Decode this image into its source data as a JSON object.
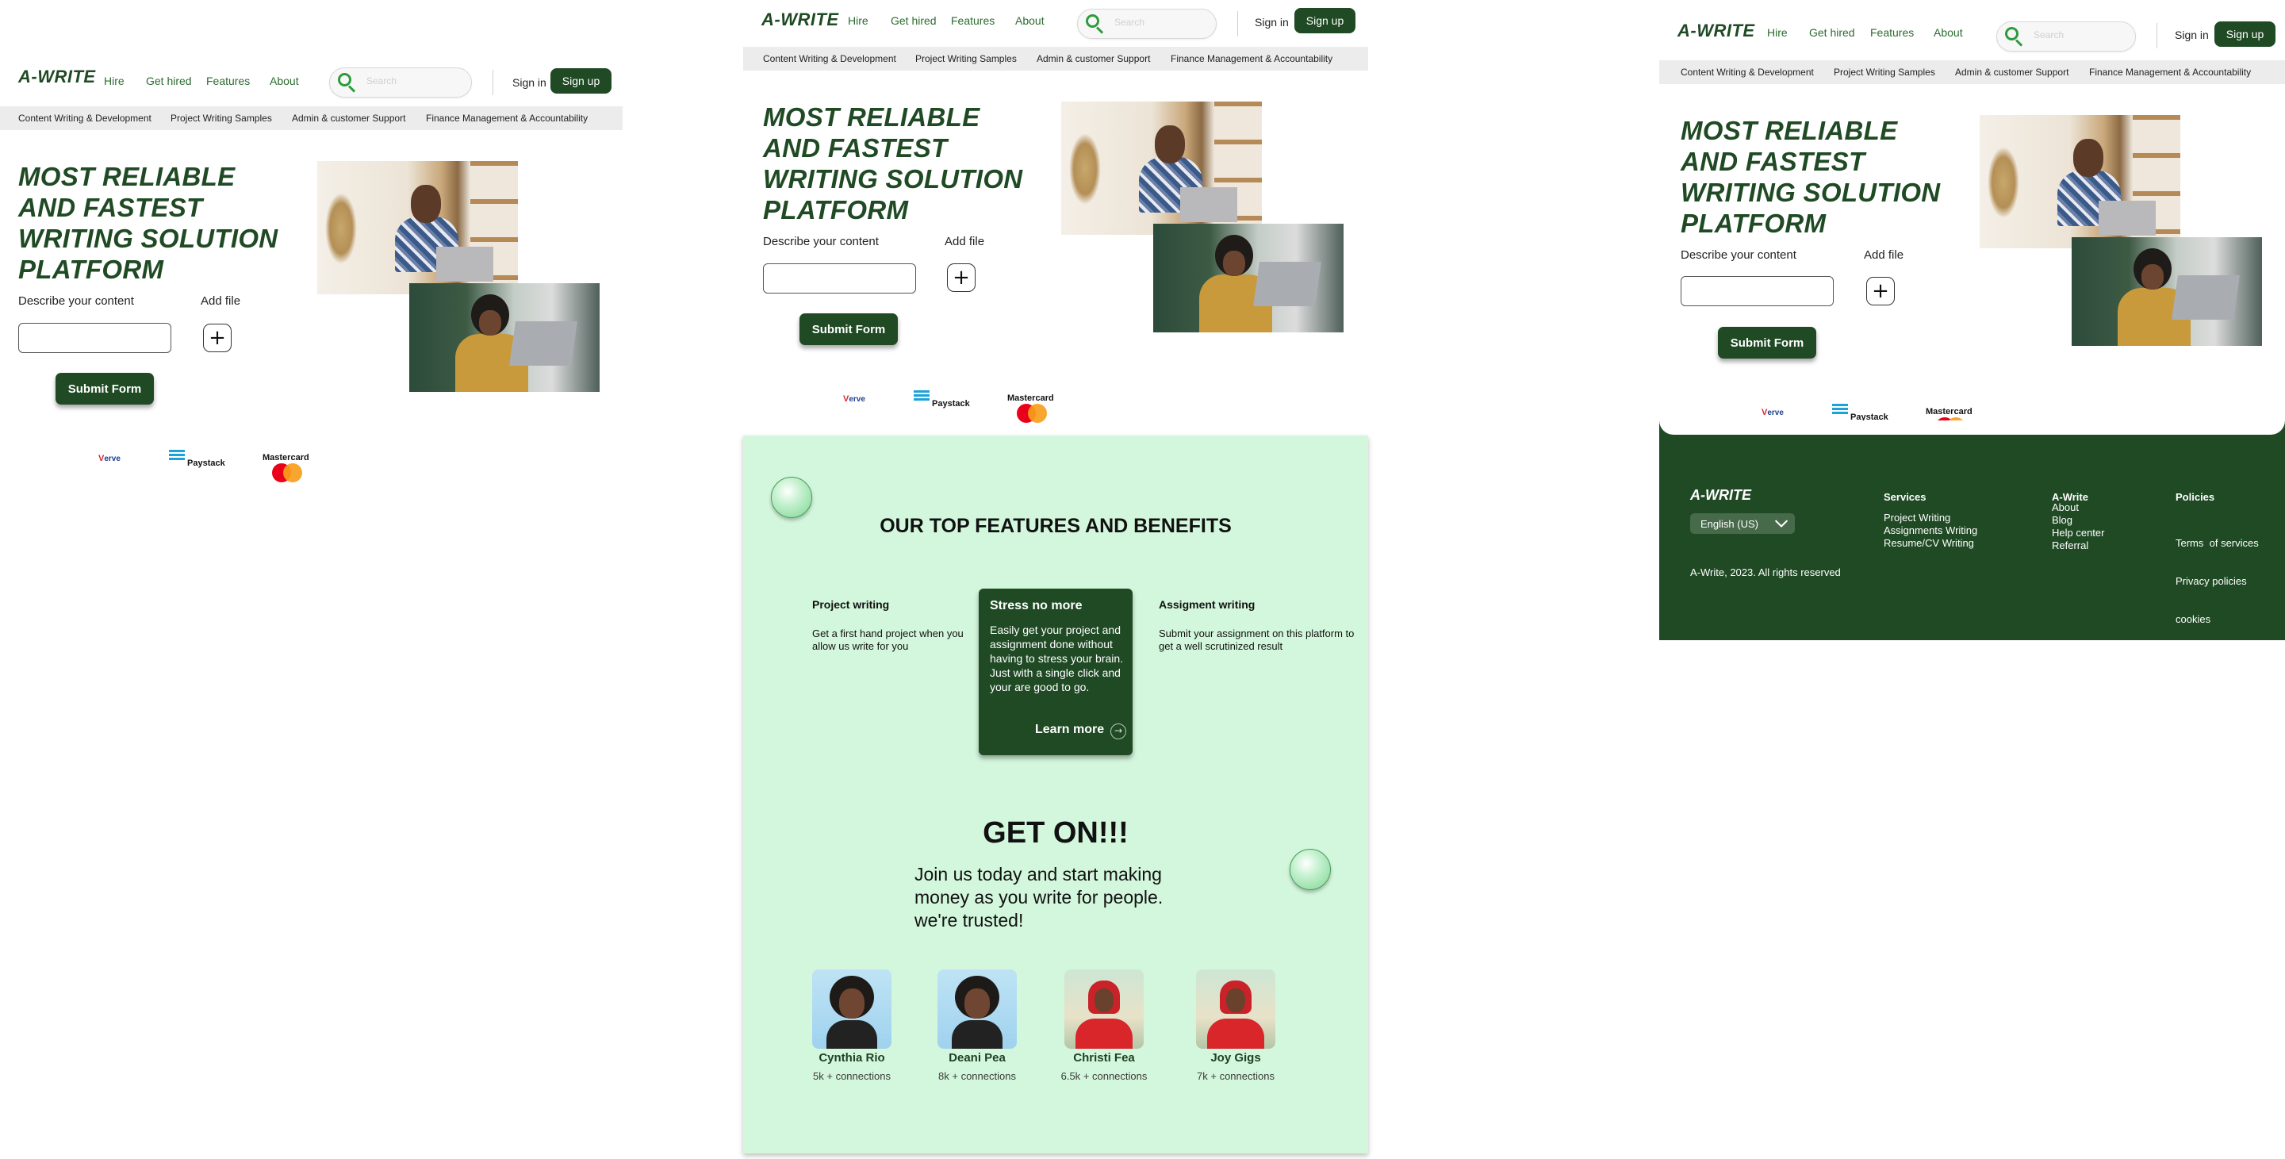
{
  "nav": {
    "logo": "A-WRITE",
    "links": [
      "Hire",
      "Get hired",
      "Features",
      "About"
    ],
    "search_placeholder": "Search",
    "signin": "Sign in",
    "signup": "Sign up"
  },
  "categories": [
    "Content Writing & Development",
    "Project Writing Samples",
    "Admin & customer Support",
    "Finance Management & Accountability"
  ],
  "hero": {
    "title": "MOST RELIABLE AND FASTEST WRITING SOLUTION PLATFORM",
    "describe_label": "Describe your content",
    "add_file_label": "Add file",
    "add_symbol": "+",
    "submit": "Submit Form"
  },
  "payments": {
    "verve_v": "V",
    "verve_rest": "erve",
    "paystack": "Paystack",
    "mastercard": "Mastercard"
  },
  "features": {
    "heading": "OUR TOP FEATURES AND BENEFITS",
    "left": {
      "title": "Project writing",
      "text": "Get a first hand project when you allow us write for you"
    },
    "card": {
      "title": "Stress no more",
      "text": "Easily get your project and assignment done without having to stress your brain. Just with a single click and your are good to go.",
      "link": "Learn more",
      "arrow": "→"
    },
    "right": {
      "title": "Assigment writing",
      "text": "Submit your assignment on this platform to get a well scrutinized result"
    }
  },
  "get_on": {
    "heading": "GET ON!!!",
    "text": "Join us today and start making money as you write for people. we're trusted!"
  },
  "writers": [
    {
      "name": "Cynthia Rio",
      "connections": "5k + connections"
    },
    {
      "name": "Deani Pea",
      "connections": "8k + connections"
    },
    {
      "name": "Christi Fea",
      "connections": "6.5k + connections"
    },
    {
      "name": "Joy Gigs",
      "connections": "7k + connections"
    }
  ],
  "footer": {
    "logo": "A-WRITE",
    "language": "English (US)",
    "copyright": "A-Write, 2023. All rights reserved",
    "services": {
      "title": "Services",
      "items": [
        "Project Writing",
        "Assignments Writing",
        "Resume/CV Writing"
      ]
    },
    "awrite": {
      "title": "A-Write",
      "items": [
        "About",
        "Blog",
        "Help center",
        "Referral"
      ]
    },
    "policies": {
      "title": "Policies",
      "items": [
        "Terms  of services",
        "Privacy policies",
        "cookies"
      ]
    }
  },
  "colors": {
    "brand_green": "#1f4a24",
    "link_green": "#2c6b2f",
    "panel_mint": "#d3f7dc",
    "category_bar": "#ececec"
  }
}
